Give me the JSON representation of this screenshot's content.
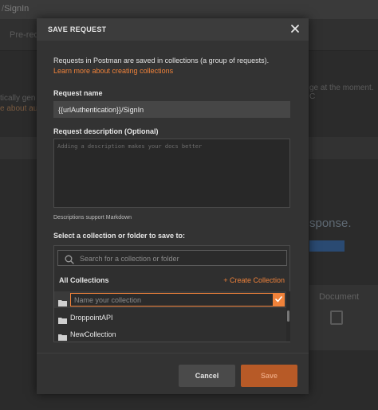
{
  "background": {
    "tab_prefix": "/",
    "tab_title": "SignIn",
    "pre_text": "Pre-req",
    "line1": "tically gen",
    "line2": "e about aut",
    "right_text": "ge at the moment. C",
    "response_label": "sponse.",
    "doc_label": "Document"
  },
  "modal": {
    "title": "SAVE REQUEST",
    "intro_text": "Requests in Postman are saved in collections (a group of requests).",
    "learn_link": "Learn more about creating collections",
    "request_name_label": "Request name",
    "request_name_value": "{{urlAuthentication}}/SignIn",
    "description_label": "Request description (Optional)",
    "description_placeholder": "Adding a description makes your docs better",
    "markdown_hint": "Descriptions support Markdown",
    "collection_label": "Select a collection or folder to save to:",
    "search_placeholder": "Search for a collection or folder",
    "all_collections": "All Collections",
    "create_collection": "+ Create Collection",
    "new_collection_placeholder": "Name your collection",
    "collections": [
      "DroppointAPI",
      "NewCollection"
    ],
    "cancel_label": "Cancel",
    "save_label": "Save"
  },
  "colors": {
    "accent": "#f0823a",
    "save_disabled": "#b75a27",
    "modal_bg": "#333333"
  }
}
